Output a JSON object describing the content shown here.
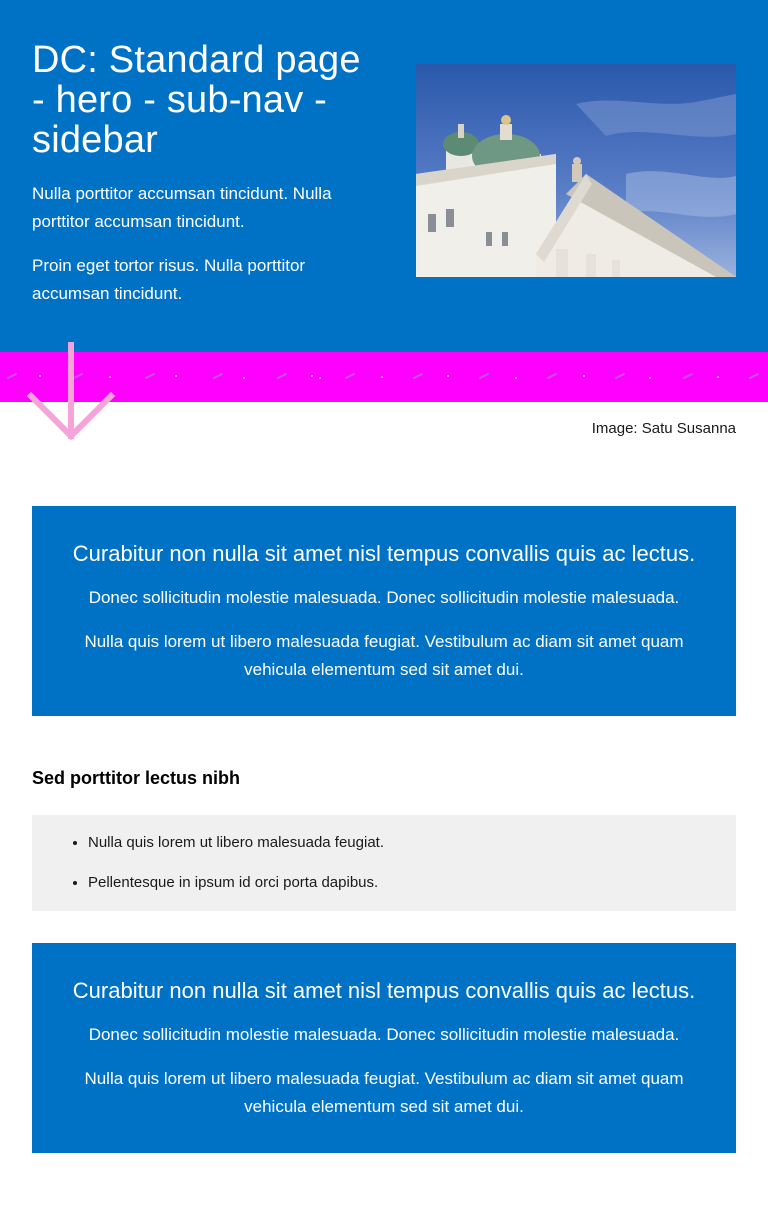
{
  "hero": {
    "title": "DC: Standard page - hero - sub-nav - sidebar",
    "paragraphs": [
      "Nulla porttitor accumsan tincidunt. Nulla porttitor accumsan tincidunt.",
      "Proin eget tortor risus. Nulla porttitor accumsan tincidunt."
    ],
    "image_alt": "Helsinki Cathedral",
    "image_credit": "Image: Satu Susanna"
  },
  "banners": [
    {
      "title": "Curabitur non nulla sit amet nisl tempus convallis quis ac lectus.",
      "text1": "Donec sollicitudin molestie malesuada. Donec sollicitudin molestie malesuada.",
      "text2": "Nulla quis lorem ut libero malesuada feugiat. Vestibulum ac diam sit amet quam vehicula elementum sed sit amet dui."
    },
    {
      "title": "Curabitur non nulla sit amet nisl tempus convallis quis ac lectus.",
      "text1": "Donec sollicitudin molestie malesuada. Donec sollicitudin molestie malesuada.",
      "text2": "Nulla quis lorem ut libero malesuada feugiat. Vestibulum ac diam sit amet quam vehicula elementum sed sit amet dui."
    }
  ],
  "section": {
    "heading": "Sed porttitor lectus nibh",
    "items": [
      "Nulla quis lorem ut libero malesuada feugiat.",
      "Pellentesque in ipsum id orci porta dapibus."
    ]
  },
  "colors": {
    "brand_blue": "#0072c6",
    "koros_pink": "#ff00ff",
    "arrow_pink": "#f5a3d8",
    "list_bg": "#f0f0f0"
  },
  "icons": {
    "arrow": "arrow-down-icon"
  }
}
